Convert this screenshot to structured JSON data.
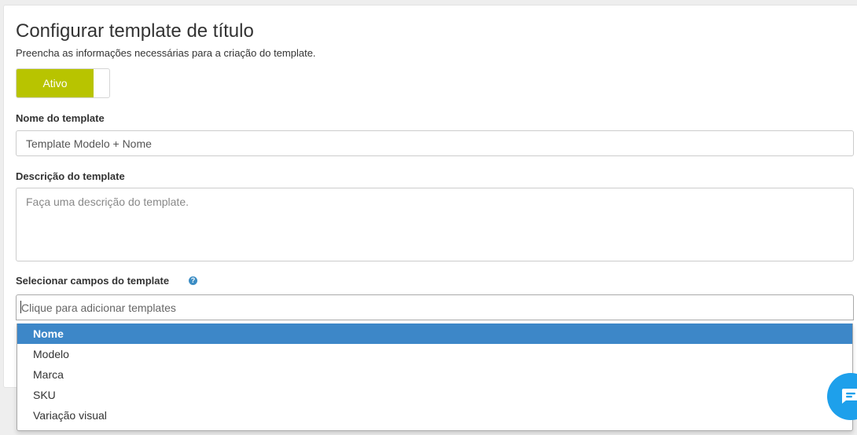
{
  "header": {
    "title": "Configurar template de título",
    "subtitle": "Preencha as informações necessárias para a criação do template."
  },
  "status_toggle": {
    "label": "Ativo",
    "state": "on",
    "active_color": "#b8c400"
  },
  "form": {
    "name_label": "Nome do template",
    "name_value": "Template Modelo + Nome",
    "description_label": "Descrição do template",
    "description_placeholder": "Faça uma descrição do template.",
    "fields_label": "Selecionar campos do template",
    "fields_placeholder": "Clique para adicionar templates"
  },
  "dropdown": {
    "highlight_color": "#3d87c8",
    "options": [
      {
        "label": "Nome",
        "highlighted": true
      },
      {
        "label": "Modelo",
        "highlighted": false
      },
      {
        "label": "Marca",
        "highlighted": false
      },
      {
        "label": "SKU",
        "highlighted": false
      },
      {
        "label": "Variação visual",
        "highlighted": false
      }
    ]
  },
  "icons": {
    "help": "question-circle-icon",
    "chat": "chat-bubble-icon"
  },
  "chat": {
    "color": "#1ea0eb"
  }
}
